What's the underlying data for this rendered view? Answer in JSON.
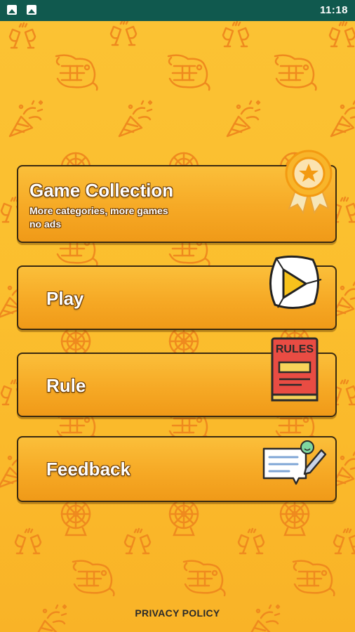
{
  "status_bar": {
    "time": "11:18",
    "icons": [
      "image-icon",
      "photo-icon"
    ]
  },
  "menu": {
    "game_collection": {
      "title": "Game Collection",
      "subtitle_line1": "More categories, more games",
      "subtitle_line2": "no ads",
      "icon": "medal-icon"
    },
    "play": {
      "label": "Play",
      "icon": "play-icon"
    },
    "rule": {
      "label": "Rule",
      "icon": "rules-book-icon",
      "icon_text": "RULES"
    },
    "feedback": {
      "label": "Feedback",
      "icon": "feedback-icon"
    }
  },
  "footer": {
    "privacy_policy": "PRIVACY POLICY"
  },
  "colors": {
    "status_bar": "#10594e",
    "background": "#fbc234",
    "card": "#f6a925",
    "pattern": "#ef8a1e",
    "text": "#ffffff"
  }
}
